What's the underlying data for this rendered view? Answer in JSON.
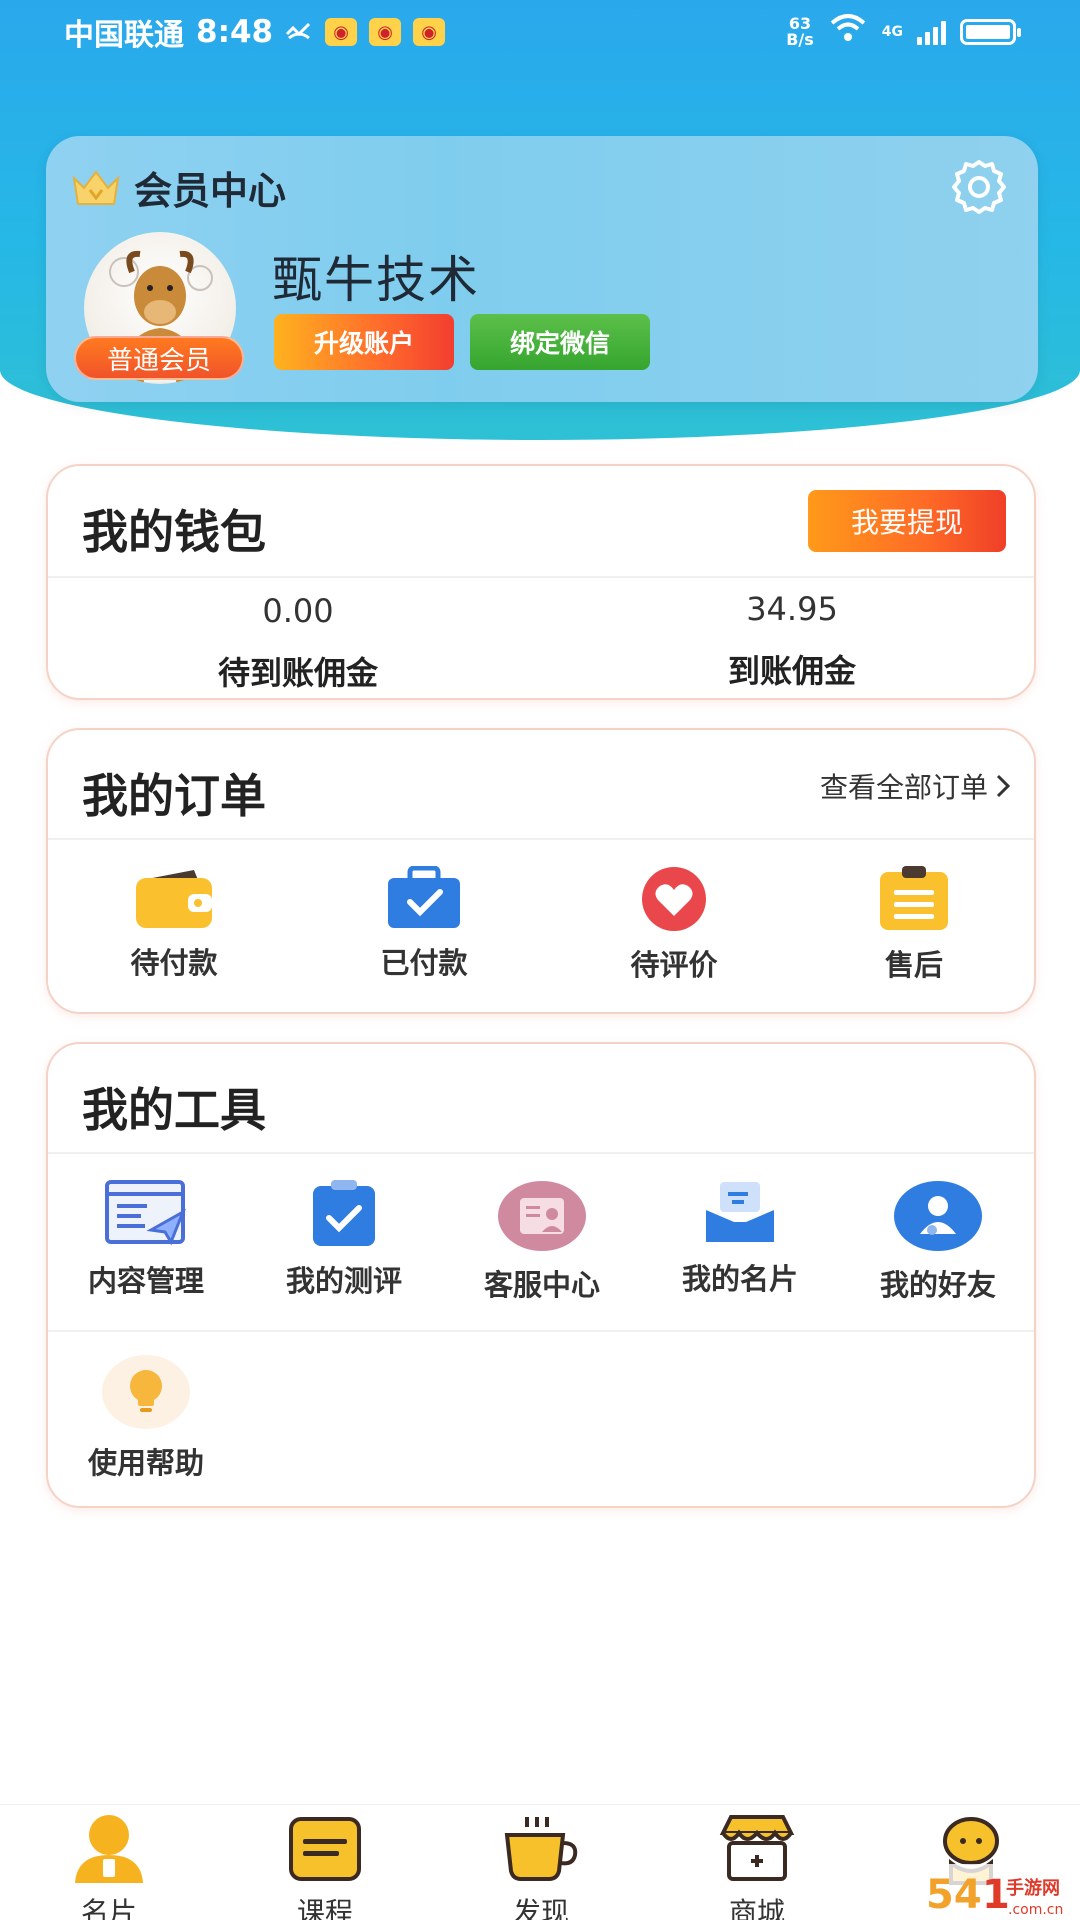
{
  "status_bar": {
    "carrier": "中国联通",
    "time": "8:48",
    "net_speed_value": "63",
    "net_speed_unit": "B/s",
    "network": "4G"
  },
  "member": {
    "title": "会员中心",
    "name": "甄牛技术",
    "level": "普通会员",
    "upgrade_label": "升级账户",
    "bind_wechat_label": "绑定微信"
  },
  "wallet": {
    "title": "我的钱包",
    "withdraw_label": "我要提现",
    "pending": {
      "value": "0.00",
      "label": "待到账佣金"
    },
    "received": {
      "value": "34.95",
      "label": "到账佣金"
    }
  },
  "orders": {
    "title": "我的订单",
    "view_all": "查看全部订单",
    "items": [
      {
        "label": "待付款",
        "icon": "wallet-icon"
      },
      {
        "label": "已付款",
        "icon": "paid-bag-icon"
      },
      {
        "label": "待评价",
        "icon": "heart-icon"
      },
      {
        "label": "售后",
        "icon": "clipboard-icon"
      }
    ]
  },
  "tools": {
    "title": "我的工具",
    "items": [
      {
        "label": "内容管理",
        "icon": "content-manage-icon"
      },
      {
        "label": "我的测评",
        "icon": "check-clipboard-icon"
      },
      {
        "label": "客服中心",
        "icon": "service-card-icon"
      },
      {
        "label": "我的名片",
        "icon": "card-holder-icon"
      },
      {
        "label": "我的好友",
        "icon": "friend-icon"
      },
      {
        "label": "使用帮助",
        "icon": "bulb-icon"
      }
    ]
  },
  "bottom_nav": {
    "items": [
      {
        "label": "名片",
        "icon": "person-icon"
      },
      {
        "label": "课程",
        "icon": "course-icon"
      },
      {
        "label": "发现",
        "icon": "coffee-icon"
      },
      {
        "label": "商城",
        "icon": "shop-icon"
      },
      {
        "label": "",
        "icon": "chat-bot-icon"
      }
    ]
  },
  "colors": {
    "primary_blue": "#2aa8ec",
    "orange": "#ff6a26",
    "green": "#35a52f",
    "panel_border": "#f5d2c6"
  }
}
